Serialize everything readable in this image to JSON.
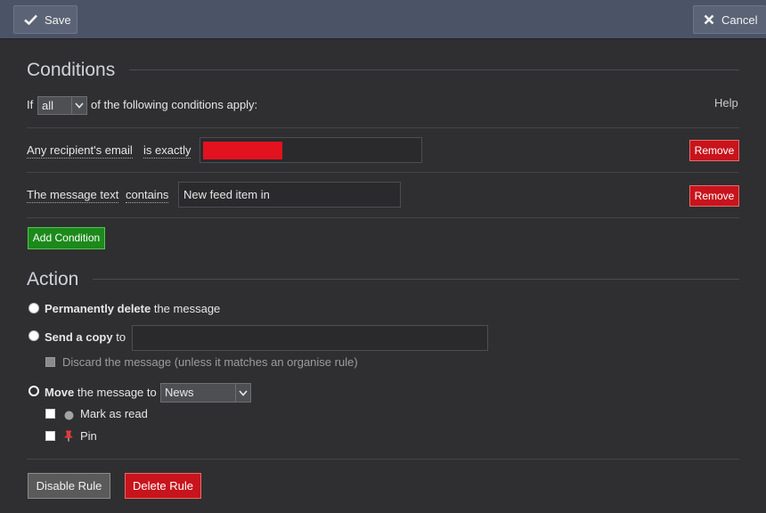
{
  "toolbar": {
    "save_label": "Save",
    "cancel_label": "Cancel"
  },
  "conditions": {
    "title": "Conditions",
    "prefix": "If",
    "match_select_value": "all",
    "suffix": "of the following conditions apply:",
    "help_label": "Help",
    "rows": [
      {
        "field": "Any recipient's email",
        "operator": "is exactly",
        "value": "",
        "remove_label": "Remove"
      },
      {
        "field": "The message text",
        "operator": "contains",
        "value": "New feed item in",
        "remove_label": "Remove"
      }
    ],
    "add_label": "Add Condition"
  },
  "action": {
    "title": "Action",
    "delete_bold": "Permanently delete",
    "delete_rest": "the message",
    "copy_bold": "Send a copy",
    "copy_rest": "to",
    "copy_value": "",
    "discard_label": "Discard the message (unless it matches an organise rule)",
    "move_bold": "Move",
    "move_rest": "the message to",
    "move_select_value": "News",
    "mark_read_label": "Mark as read",
    "pin_label": "Pin",
    "selected_option": "move"
  },
  "footer": {
    "disable_label": "Disable Rule",
    "delete_label": "Delete Rule"
  },
  "colors": {
    "toolbar": "#4b5466",
    "danger": "#c8141c",
    "success": "#1b8a1b",
    "background": "#2f2f31"
  },
  "icons": {
    "save": "checkmark-icon",
    "cancel": "close-icon",
    "read": "dot-icon",
    "pin": "pushpin-icon"
  }
}
